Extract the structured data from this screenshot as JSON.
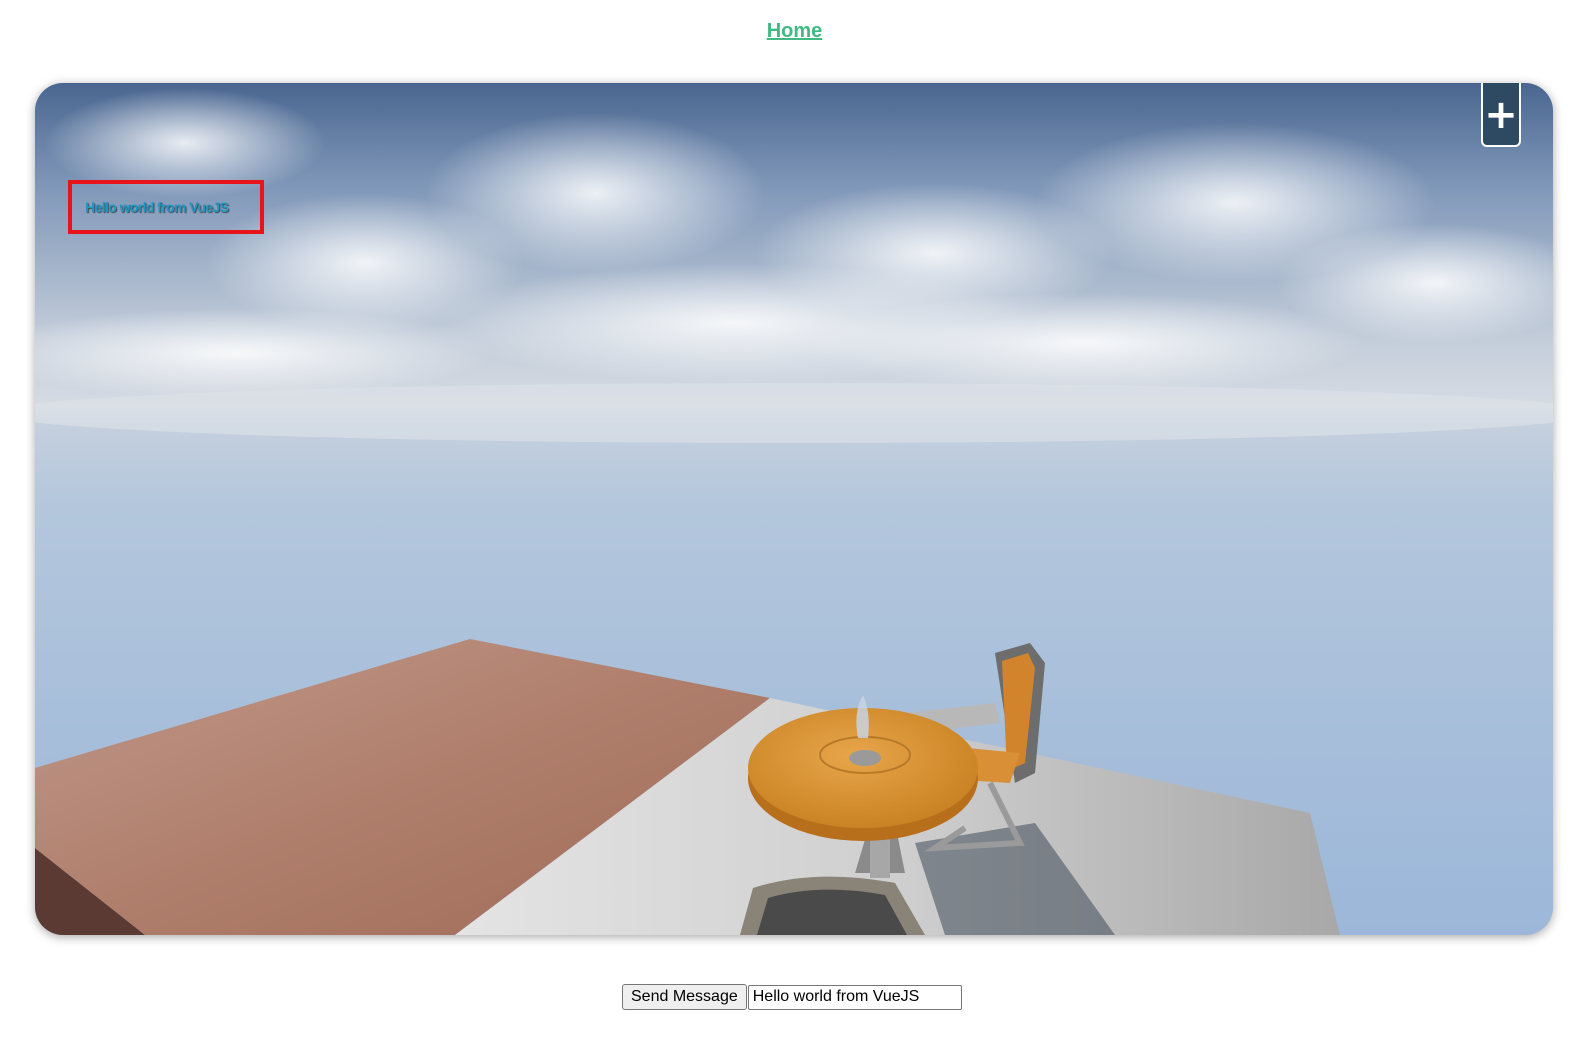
{
  "nav": {
    "home_label": "Home"
  },
  "viewport": {
    "overlay_message": "Hello world from VueJS",
    "expand_button_label": "+"
  },
  "controls": {
    "send_button_label": "Send Message",
    "message_input_value": "Hello world from VueJS"
  },
  "colors": {
    "link": "#42b983",
    "overlay_border": "#e8141c",
    "overlay_text": "#2496c0",
    "expand_button_bg": "#2e4a63"
  }
}
